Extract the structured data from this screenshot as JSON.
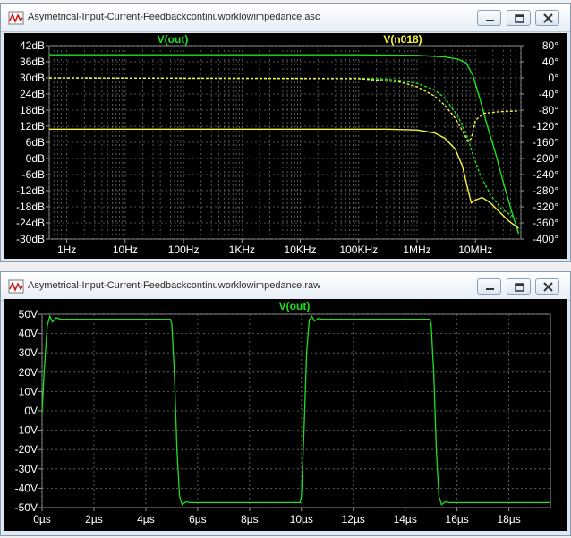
{
  "window1": {
    "title": "Asymetrical-Input-Current-Feedbackcontinuworklowimpedance.asc",
    "trace_labels": [
      "V(out)",
      "V(n018)"
    ]
  },
  "window2": {
    "title": "Asymetrical-Input-Current-Feedbackcontinuworklowimpedance.raw",
    "trace_labels": [
      "V(out)"
    ]
  },
  "colors": {
    "plot_bg": "#000000",
    "trace_out": "#1ee11e",
    "trace_n018": "#f5f542",
    "axis_text": "#ffffff",
    "frame": "#9a9a9a"
  },
  "icons": [
    "ltspice-app-icon",
    "minimize-icon",
    "restore-icon",
    "close-icon"
  ],
  "chart_data": [
    {
      "type": "line",
      "title": "",
      "x_scale": "log",
      "xlim": [
        0.5,
        60000000
      ],
      "x_tick_labels": [
        "1Hz",
        "10Hz",
        "100Hz",
        "1KHz",
        "10KHz",
        "100KHz",
        "1MHz",
        "10MHz"
      ],
      "x_tick_values": [
        1,
        10,
        100,
        1000,
        10000,
        100000,
        1000000,
        10000000
      ],
      "y_left_label_unit": "dB",
      "y_left_lim": [
        -30,
        42
      ],
      "y_left_ticks": [
        "42dB",
        "36dB",
        "30dB",
        "24dB",
        "18dB",
        "12dB",
        "6dB",
        "0dB",
        "-6dB",
        "-12dB",
        "-18dB",
        "-24dB",
        "-30dB"
      ],
      "y_right_lim": [
        -400,
        80
      ],
      "y_right_ticks": [
        "80°",
        "40°",
        "0°",
        "-40°",
        "-80°",
        "-120°",
        "-160°",
        "-200°",
        "-240°",
        "-280°",
        "-320°",
        "-360°",
        "-400°"
      ],
      "grid": true,
      "series": [
        {
          "name": "V(out)",
          "kind": "magnitude",
          "axis": "left",
          "style": "solid",
          "color": "#1ee11e",
          "points": [
            [
              0.5,
              38.6
            ],
            [
              100000,
              38.6
            ],
            [
              1000000,
              38.4
            ],
            [
              3000000,
              37.8
            ],
            [
              5000000,
              37.0
            ],
            [
              7000000,
              35.5
            ],
            [
              9000000,
              31
            ],
            [
              12000000,
              22
            ],
            [
              16000000,
              12
            ],
            [
              22000000,
              2
            ],
            [
              30000000,
              -9
            ],
            [
              42000000,
              -20
            ],
            [
              55000000,
              -28
            ]
          ]
        },
        {
          "name": "V(out)",
          "kind": "phase",
          "axis": "right",
          "style": "dashed",
          "color": "#1ee11e",
          "points": [
            [
              0.5,
              0
            ],
            [
              200000,
              -2
            ],
            [
              500000,
              -6
            ],
            [
              1000000,
              -14
            ],
            [
              2000000,
              -30
            ],
            [
              3000000,
              -50
            ],
            [
              5000000,
              -95
            ],
            [
              7000000,
              -140
            ],
            [
              9000000,
              -190
            ],
            [
              12000000,
              -240
            ],
            [
              18000000,
              -290
            ],
            [
              28000000,
              -325
            ],
            [
              45000000,
              -345
            ],
            [
              55000000,
              -352
            ]
          ]
        },
        {
          "name": "V(n018)",
          "kind": "magnitude",
          "axis": "left",
          "style": "solid",
          "color": "#f5f542",
          "points": [
            [
              0.5,
              10.9
            ],
            [
              300000,
              10.9
            ],
            [
              1000000,
              10.6
            ],
            [
              2000000,
              9.5
            ],
            [
              3000000,
              7.5
            ],
            [
              4500000,
              3.5
            ],
            [
              6000000,
              -3
            ],
            [
              7500000,
              -12
            ],
            [
              8500000,
              -16.5
            ],
            [
              10000000,
              -15.5
            ],
            [
              13000000,
              -14.5
            ],
            [
              18000000,
              -16.5
            ],
            [
              26000000,
              -20
            ],
            [
              38000000,
              -23.5
            ],
            [
              55000000,
              -26
            ]
          ]
        },
        {
          "name": "V(n018)",
          "kind": "phase",
          "axis": "right",
          "style": "dashed",
          "color": "#f5f542",
          "points": [
            [
              0.5,
              0
            ],
            [
              100000,
              -2
            ],
            [
              500000,
              -10
            ],
            [
              1000000,
              -22
            ],
            [
              2000000,
              -45
            ],
            [
              3000000,
              -68
            ],
            [
              4500000,
              -100
            ],
            [
              6000000,
              -132
            ],
            [
              7500000,
              -158
            ],
            [
              8500000,
              -150
            ],
            [
              10000000,
              -105
            ],
            [
              14000000,
              -88
            ],
            [
              25000000,
              -84
            ],
            [
              55000000,
              -82
            ]
          ]
        }
      ]
    },
    {
      "type": "line",
      "title": "",
      "xlim": [
        0,
        19.6
      ],
      "x_unit": "µs",
      "x_tick_labels": [
        "0µs",
        "2µs",
        "4µs",
        "6µs",
        "8µs",
        "10µs",
        "12µs",
        "14µs",
        "16µs",
        "18µs"
      ],
      "x_tick_values": [
        0,
        2,
        4,
        6,
        8,
        10,
        12,
        14,
        16,
        18
      ],
      "ylim": [
        -50,
        50
      ],
      "y_tick_labels": [
        "50V",
        "40V",
        "30V",
        "20V",
        "10V",
        "0V",
        "-10V",
        "-20V",
        "-30V",
        "-40V",
        "-50V"
      ],
      "y_tick_values": [
        50,
        40,
        30,
        20,
        10,
        0,
        -10,
        -20,
        -30,
        -40,
        -50
      ],
      "grid": true,
      "series": [
        {
          "name": "V(out)",
          "color": "#1ee11e",
          "points": [
            [
              0,
              -1
            ],
            [
              0.08,
              20
            ],
            [
              0.2,
              44
            ],
            [
              0.3,
              49
            ],
            [
              0.4,
              46
            ],
            [
              0.55,
              48.2
            ],
            [
              0.7,
              47.4
            ],
            [
              4.95,
              47.4
            ],
            [
              5.0,
              45
            ],
            [
              5.1,
              20
            ],
            [
              5.2,
              -20
            ],
            [
              5.3,
              -44
            ],
            [
              5.4,
              -48.5
            ],
            [
              5.55,
              -47
            ],
            [
              5.7,
              -47.4
            ],
            [
              9.95,
              -47.4
            ],
            [
              10.0,
              -44
            ],
            [
              10.1,
              -10
            ],
            [
              10.2,
              30
            ],
            [
              10.3,
              47
            ],
            [
              10.4,
              49
            ],
            [
              10.5,
              46.5
            ],
            [
              10.65,
              47.8
            ],
            [
              10.8,
              47.4
            ],
            [
              14.95,
              47.4
            ],
            [
              15.0,
              45
            ],
            [
              15.1,
              20
            ],
            [
              15.2,
              -20
            ],
            [
              15.3,
              -44
            ],
            [
              15.4,
              -48.5
            ],
            [
              15.55,
              -47
            ],
            [
              15.7,
              -47.4
            ],
            [
              19.6,
              -47.4
            ]
          ]
        }
      ]
    }
  ]
}
